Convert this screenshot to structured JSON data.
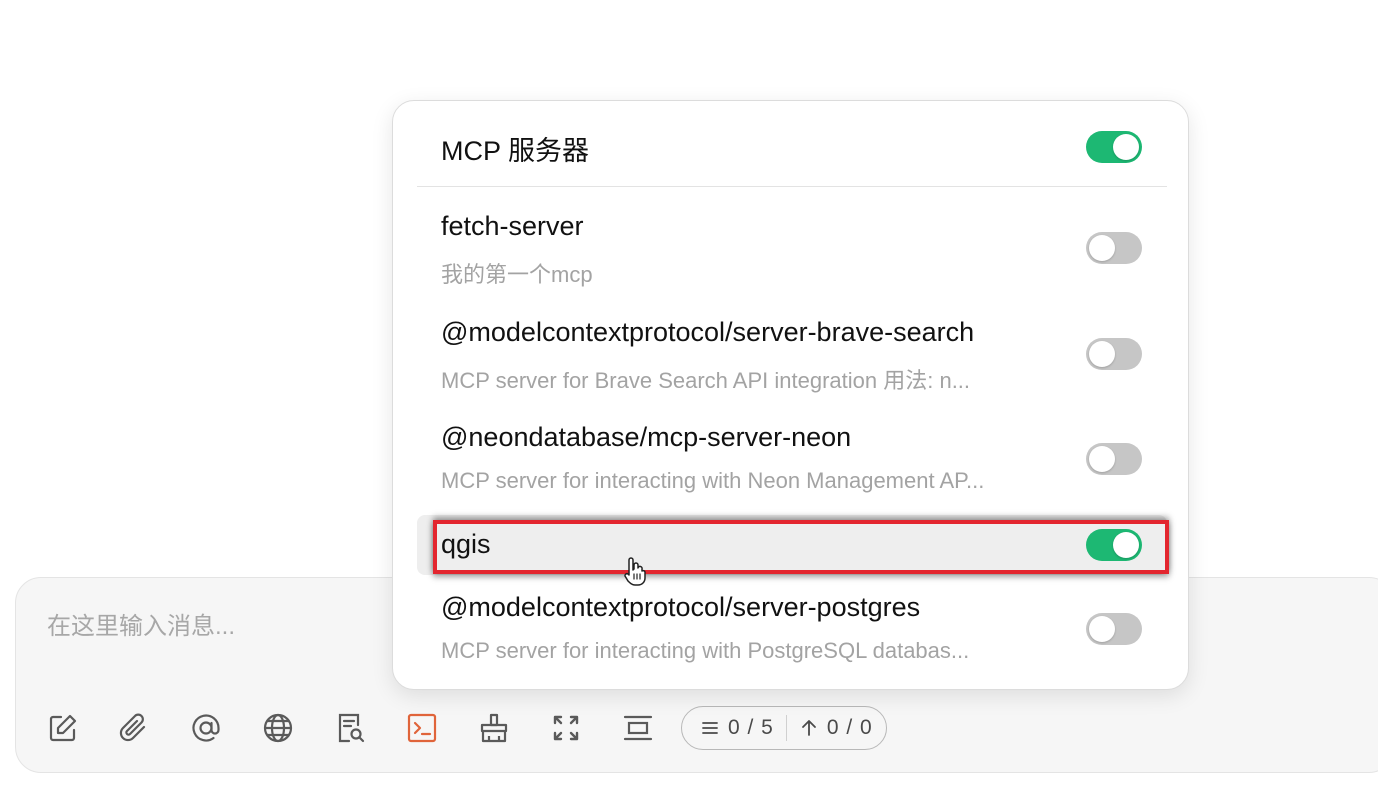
{
  "composer": {
    "placeholder": "在这里输入消息...",
    "counter": {
      "messages": "0 / 5",
      "tokens": "0 / 0"
    }
  },
  "toolbar": {
    "icons": [
      "new-chat-icon",
      "attach-icon",
      "mention-icon",
      "web-search-icon",
      "document-search-icon",
      "terminal-icon",
      "clear-icon",
      "expand-icon",
      "collapse-icon"
    ],
    "active_color": "#e0643a"
  },
  "mcp_popup": {
    "title": "MCP 服务器",
    "enabled": true,
    "servers": [
      {
        "name": "fetch-server",
        "description": "我的第一个mcp",
        "enabled": false
      },
      {
        "name": "@modelcontextprotocol/server-brave-search",
        "description": "MCP server for Brave Search API integration 用法: n...",
        "enabled": false
      },
      {
        "name": "@neondatabase/mcp-server-neon",
        "description": "MCP server for interacting with Neon Management AP...",
        "enabled": false
      },
      {
        "name": "qgis",
        "description": "",
        "enabled": true
      },
      {
        "name": "@modelcontextprotocol/server-postgres",
        "description": "MCP server for interacting with PostgreSQL databas...",
        "enabled": false
      }
    ]
  },
  "colors": {
    "toggle_on": "#1db873",
    "toggle_off": "#c6c6c6",
    "highlight_border": "#e3262f"
  }
}
